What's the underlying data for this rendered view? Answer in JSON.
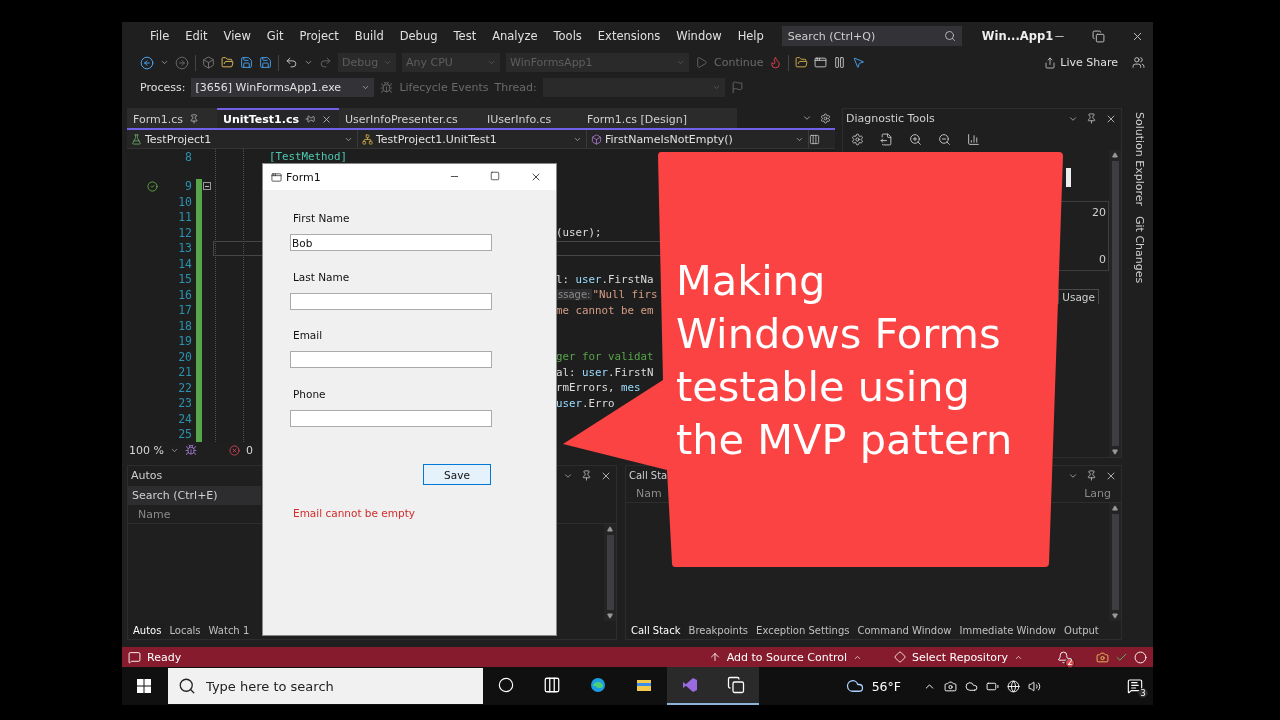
{
  "menu_bar": {
    "items": [
      "File",
      "Edit",
      "View",
      "Git",
      "Project",
      "Build",
      "Debug",
      "Test",
      "Analyze",
      "Tools",
      "Extensions",
      "Window",
      "Help"
    ],
    "search": {
      "placeholder": "Search (Ctrl+Q)"
    },
    "solution_name": "Win...App1"
  },
  "toolbar": {
    "configuration": "Debug",
    "platform": "Any CPU",
    "startup_project": "WinFormsApp1",
    "continue": "Continue",
    "live_share": "Live Share"
  },
  "debug_toolbar": {
    "process_label": "Process:",
    "process": "[3656] WinFormsApp1.exe",
    "lifecycle_events": "Lifecycle Events",
    "thread_label": "Thread:"
  },
  "document_tabs": [
    {
      "label": "Form1.cs",
      "selected": false,
      "pinned": true
    },
    {
      "label": "UnitTest1.cs",
      "selected": true,
      "pinned": false
    },
    {
      "label": "UserInfoPresenter.cs",
      "selected": false,
      "pinned": false
    },
    {
      "label": "IUserInfo.cs",
      "selected": false,
      "pinned": false
    },
    {
      "label": "Form1.cs [Design]",
      "selected": false,
      "pinned": false
    }
  ],
  "navigation_bar": {
    "project": "TestProject1",
    "class": "TestProject1.UnitTest1",
    "member": "FirstNameIsNotEmpty()"
  },
  "editor": {
    "lines": [
      {
        "number": "8",
        "kind": "full",
        "current": false,
        "segments": [
          {
            "kind": "attribute",
            "text": "[TestMethod]"
          }
        ]
      },
      {
        "number": "9",
        "kind": "test",
        "current": false
      },
      {
        "number": "10",
        "kind": "fragment",
        "current": false
      },
      {
        "number": "11",
        "kind": "fragment",
        "current": false
      },
      {
        "number": "12",
        "kind": "fragment",
        "current": false,
        "segments": [
          {
            "kind": "plain",
            "text": "(user);"
          }
        ]
      },
      {
        "number": "13",
        "kind": "fragment",
        "current": true
      },
      {
        "number": "14",
        "kind": "fragment",
        "current": false
      },
      {
        "number": "15",
        "kind": "fragment",
        "current": false,
        "segments": [
          {
            "kind": "plain",
            "text": "l: "
          },
          {
            "kind": "identifier",
            "text": "user"
          },
          {
            "kind": "plain",
            "text": ".FirstNa"
          }
        ]
      },
      {
        "number": "16",
        "kind": "fragment",
        "current": false,
        "segments": [
          {
            "kind": "hint",
            "text": "ssage:"
          },
          {
            "kind": "string",
            "text": "\"Null firs"
          }
        ]
      },
      {
        "number": "17",
        "kind": "fragment",
        "current": false,
        "segments": [
          {
            "kind": "string",
            "text": "me cannot be em"
          }
        ]
      },
      {
        "number": "18",
        "kind": "fragment",
        "current": false
      },
      {
        "number": "19",
        "kind": "fragment",
        "current": false
      },
      {
        "number": "20",
        "kind": "fragment",
        "current": false,
        "segments": [
          {
            "kind": "comment",
            "text": "ger for validat"
          }
        ]
      },
      {
        "number": "21",
        "kind": "fragment",
        "current": false,
        "segments": [
          {
            "kind": "plain",
            "text": "al: "
          },
          {
            "kind": "identifier",
            "text": "user"
          },
          {
            "kind": "plain",
            "text": ".FirstN"
          }
        ]
      },
      {
        "number": "22",
        "kind": "fragment",
        "current": false,
        "segments": [
          {
            "kind": "plain",
            "text": "rmErrors, "
          },
          {
            "kind": "identifier",
            "text": "mes"
          }
        ]
      },
      {
        "number": "23",
        "kind": "fragment",
        "current": false,
        "segments": [
          {
            "kind": "identifier",
            "text": "user"
          },
          {
            "kind": "plain",
            "text": ".Erro"
          }
        ]
      },
      {
        "number": "24",
        "kind": "fragment",
        "current": false
      },
      {
        "number": "25",
        "kind": "fragment",
        "current": false
      }
    ],
    "zoom": "100 %",
    "error_count": "0"
  },
  "diagnostic_tools": {
    "title": "Diagnostic Tools",
    "axis_labels": [
      "20",
      "0"
    ],
    "tab": "Usage"
  },
  "side_tabs": [
    "Solution Explorer",
    "Git Changes"
  ],
  "autos": {
    "title": "Autos",
    "search": {
      "placeholder": "Search (Ctrl+E)"
    },
    "column": "Name",
    "tabs": [
      {
        "label": "Autos",
        "selected": true
      },
      {
        "label": "Locals",
        "selected": false
      },
      {
        "label": "Watch 1",
        "selected": false
      }
    ]
  },
  "call_stack": {
    "title": "Call Sta",
    "columns": [
      "Nam",
      "Lang"
    ],
    "tabs": [
      {
        "label": "Call Stack",
        "selected": true
      },
      {
        "label": "Breakpoints",
        "selected": false
      },
      {
        "label": "Exception Settings",
        "selected": false
      },
      {
        "label": "Command Window",
        "selected": false
      },
      {
        "label": "Immediate Window",
        "selected": false
      },
      {
        "label": "Output",
        "selected": false
      }
    ]
  },
  "status_bar": {
    "text": "Ready",
    "source_control": "Add to Source Control",
    "repository": "Select Repository",
    "notification_count": "2"
  },
  "taskbar": {
    "search": {
      "placeholder": "Type here to search"
    },
    "apps": [
      {
        "kind": "edge",
        "running": false
      },
      {
        "kind": "explorer",
        "running": false
      },
      {
        "kind": "visual-studio",
        "running": true
      },
      {
        "kind": "window",
        "running": true
      }
    ],
    "weather": "56°F",
    "notification_count": "3"
  },
  "form_window": {
    "title": "Form1",
    "fields": [
      {
        "label": "First Name",
        "value": "Bob"
      },
      {
        "label": "Last Name"
      },
      {
        "label": "Email"
      },
      {
        "label": "Phone"
      }
    ],
    "button": "Save",
    "error": "Email cannot be empty"
  },
  "callout": {
    "lines": [
      "Making",
      "Windows Forms",
      "testable using",
      "the MVP pattern"
    ]
  }
}
